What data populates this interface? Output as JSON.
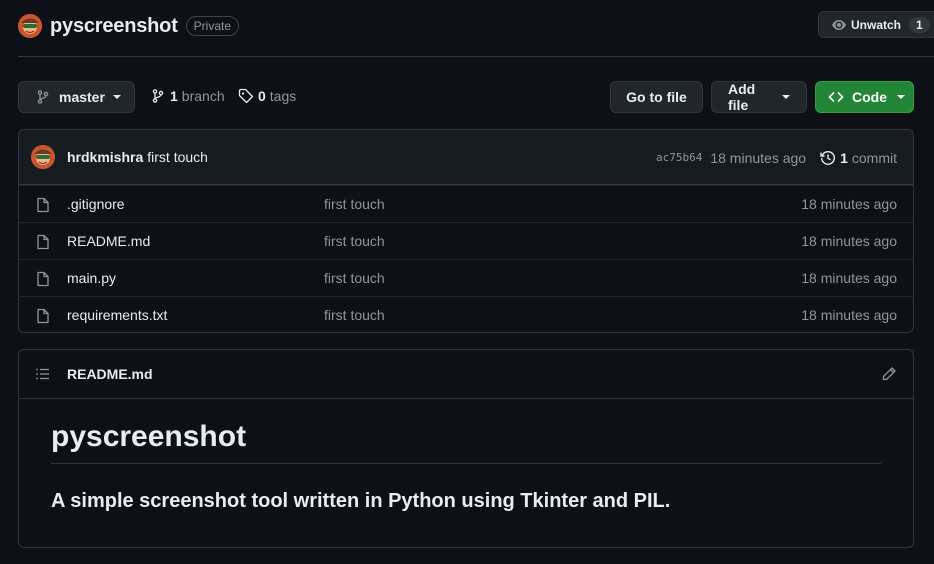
{
  "repo": {
    "name": "pyscreenshot",
    "visibility": "Private"
  },
  "watch": {
    "label": "Unwatch",
    "count": "1"
  },
  "branch_bar": {
    "current_branch": "master",
    "branch_count": "1",
    "branch_word": "branch",
    "tag_count": "0",
    "tag_word": "tags",
    "goto_file_label": "Go to file",
    "add_file_label": "Add file",
    "code_label": "Code"
  },
  "latest_commit": {
    "author": "hrdkmishra",
    "message": "first touch",
    "sha": "ac75b64",
    "time": "18 minutes ago",
    "commit_count": "1",
    "commit_word": "commit"
  },
  "files": [
    {
      "name": ".gitignore",
      "message": "first touch",
      "time": "18 minutes ago"
    },
    {
      "name": "README.md",
      "message": "first touch",
      "time": "18 minutes ago"
    },
    {
      "name": "main.py",
      "message": "first touch",
      "time": "18 minutes ago"
    },
    {
      "name": "requirements.txt",
      "message": "first touch",
      "time": "18 minutes ago"
    }
  ],
  "readme": {
    "filename": "README.md",
    "heading": "pyscreenshot",
    "body": "A simple screenshot tool written in Python using Tkinter and PIL."
  },
  "colors": {
    "background": "#0d1117",
    "border": "#30363d",
    "code_button": "#238636",
    "muted_text": "#8d96a0"
  },
  "icons": [
    "avatar",
    "eye-icon",
    "git-branch-icon",
    "tag-icon",
    "code-icon",
    "history-icon",
    "file-icon",
    "list-icon",
    "pencil-icon",
    "caret-down-icon"
  ]
}
